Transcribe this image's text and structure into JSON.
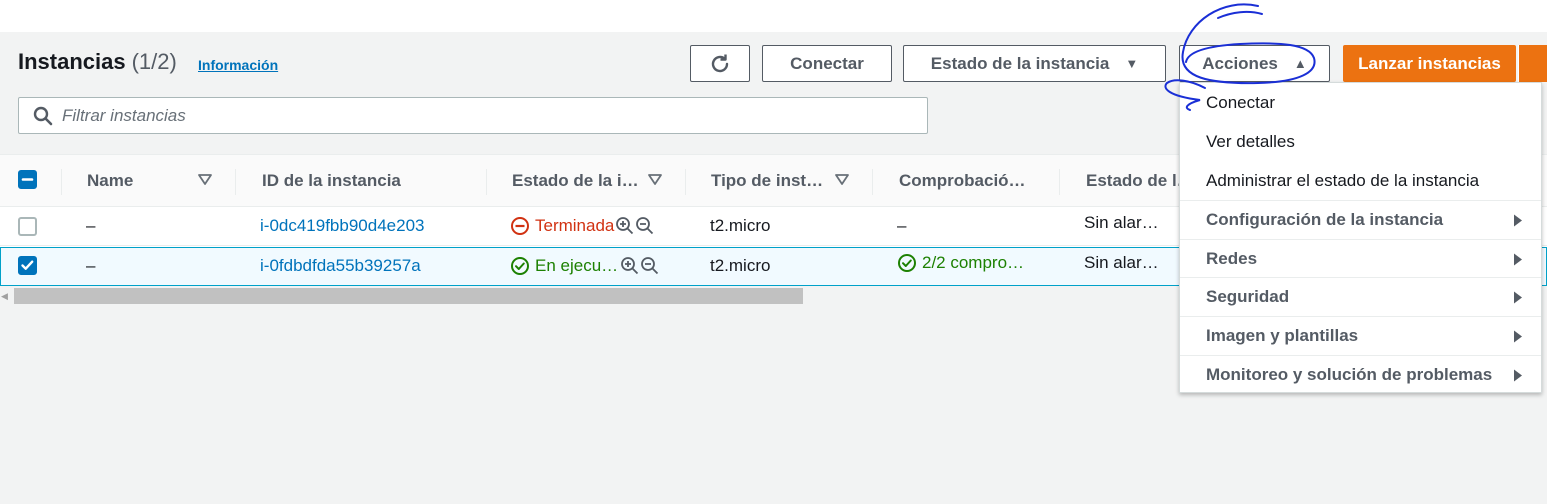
{
  "header": {
    "title": "Instancias",
    "count": "(1/2)",
    "info_link": "Información"
  },
  "toolbar": {
    "connect_label": "Conectar",
    "state_label": "Estado de la instancia",
    "actions_label": "Acciones",
    "launch_label": "Lanzar instancias"
  },
  "search": {
    "placeholder": "Filtrar instancias"
  },
  "table": {
    "columns": [
      "Name",
      "ID de la instancia",
      "Estado de la i…",
      "Tipo de inst…",
      "Comprobació…",
      "Estado de l…"
    ],
    "rows": [
      {
        "name": "–",
        "id": "i-0dc419fbb90d4e203",
        "state": "Terminada",
        "type": "t2.micro",
        "check": "–",
        "alarm": "Sin alar…",
        "selected": false
      },
      {
        "name": "–",
        "id": "i-0fdbdfda55b39257a",
        "state": "En ejecu…",
        "type": "t2.micro",
        "check": "2/2 compro…",
        "alarm": "Sin alar…",
        "selected": true
      }
    ]
  },
  "actions_menu": {
    "items": [
      {
        "label": "Conectar",
        "submenu": false
      },
      {
        "label": "Ver detalles",
        "submenu": false
      },
      {
        "label": "Administrar el estado de la instancia",
        "submenu": false
      },
      {
        "label": "Configuración de la instancia",
        "submenu": true
      },
      {
        "label": "Redes",
        "submenu": true
      },
      {
        "label": "Seguridad",
        "submenu": true
      },
      {
        "label": "Imagen y plantillas",
        "submenu": true
      },
      {
        "label": "Monitoreo y solución de problemas",
        "submenu": true
      }
    ]
  },
  "colors": {
    "accent_orange": "#ec7211",
    "link_blue": "#0073bb",
    "terminated_red": "#d13212",
    "running_green": "#1d8102",
    "annotation_ink": "#1a2fd6"
  },
  "icons": {
    "refresh": "refresh-icon",
    "search": "search-icon",
    "sort": "sort-down-icon",
    "zoom_in": "zoom-in-icon",
    "zoom_out": "zoom-out-icon",
    "terminated": "stop-circle-icon",
    "running": "check-circle-icon",
    "submenu": "caret-right-icon"
  }
}
